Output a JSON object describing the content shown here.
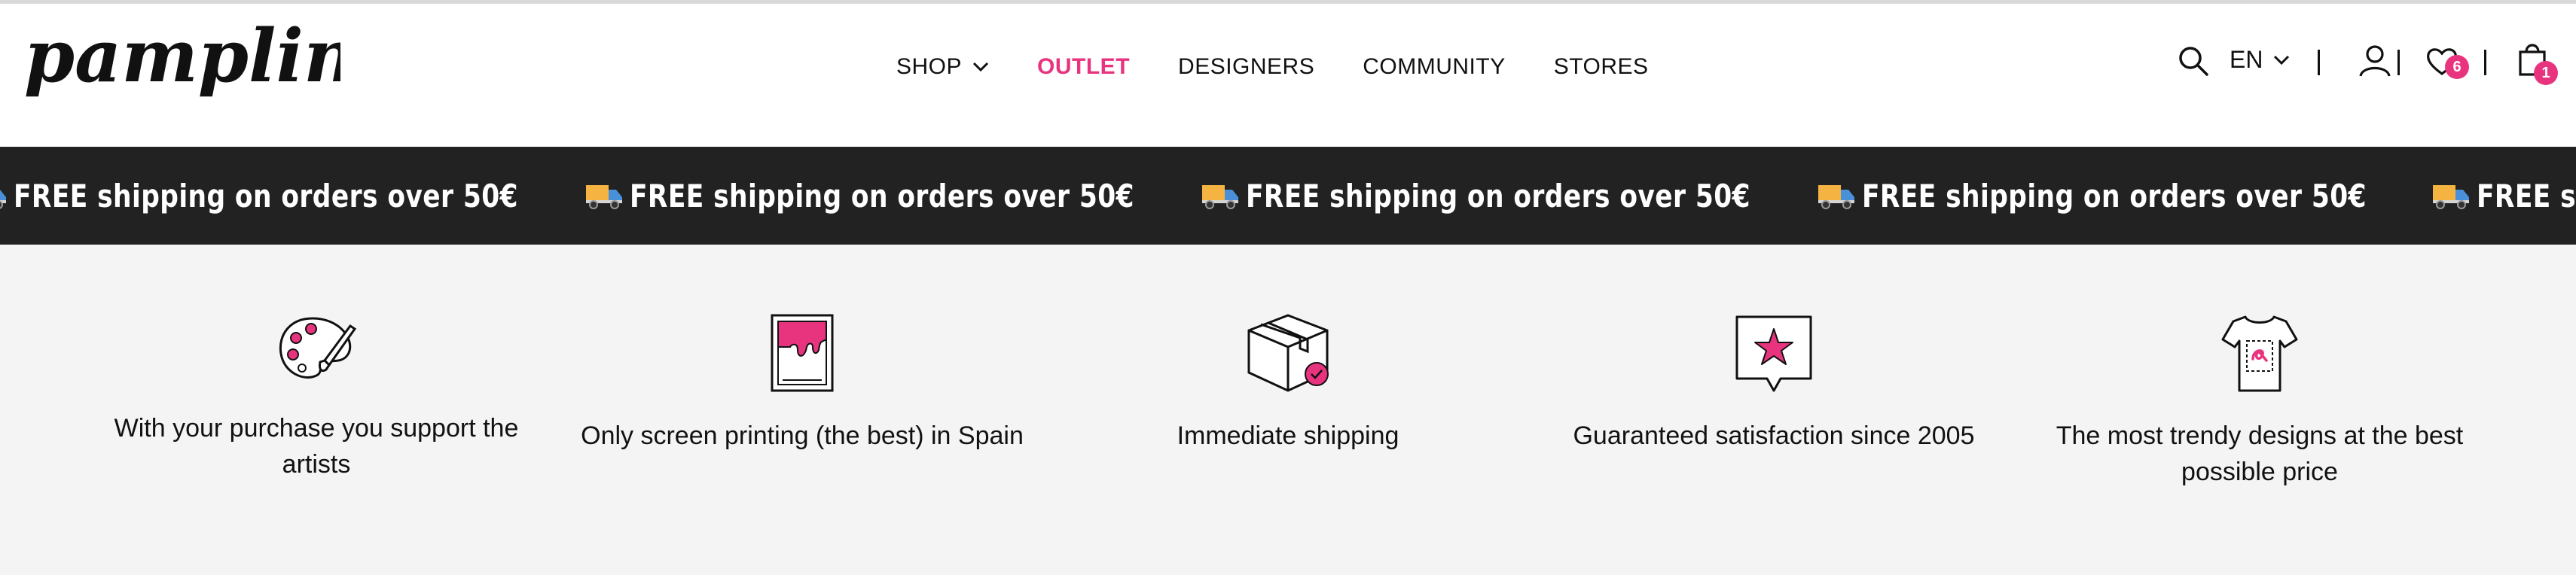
{
  "brand": {
    "logo_text": "pampling",
    "accent": "#e8347f",
    "banner_bg": "#222222"
  },
  "nav": {
    "items": [
      {
        "label": "SHOP",
        "dropdown": true
      },
      {
        "label": "OUTLET",
        "highlight": true
      },
      {
        "label": "DESIGNERS"
      },
      {
        "label": "COMMUNITY"
      },
      {
        "label": "STORES"
      }
    ]
  },
  "tools": {
    "search_icon": "search-icon",
    "language": "EN",
    "account_icon": "user-icon",
    "wishlist_icon": "heart-icon",
    "wishlist_count": "6",
    "cart_icon": "shopping-bag-icon",
    "cart_count": "1"
  },
  "banner": {
    "icon": "delivery-truck-icon",
    "messages": [
      "FREE shipping on orders over 50€",
      "FREE shipping on orders over 50€",
      "FREE shipping on orders over 50€",
      "FREE shipping on orders over 50€",
      "FREE sh"
    ]
  },
  "features": [
    {
      "icon": "palette-icon",
      "text": "With your purchase you support the artists"
    },
    {
      "icon": "screen-print-frame-icon",
      "text": "Only screen printing (the best) in Spain"
    },
    {
      "icon": "package-box-icon",
      "text": "Immediate shipping"
    },
    {
      "icon": "star-speech-bubble-icon",
      "text": "Guaranteed satisfaction since 2005"
    },
    {
      "icon": "tshirt-icon",
      "text": "The most trendy designs at the best possible price"
    }
  ]
}
